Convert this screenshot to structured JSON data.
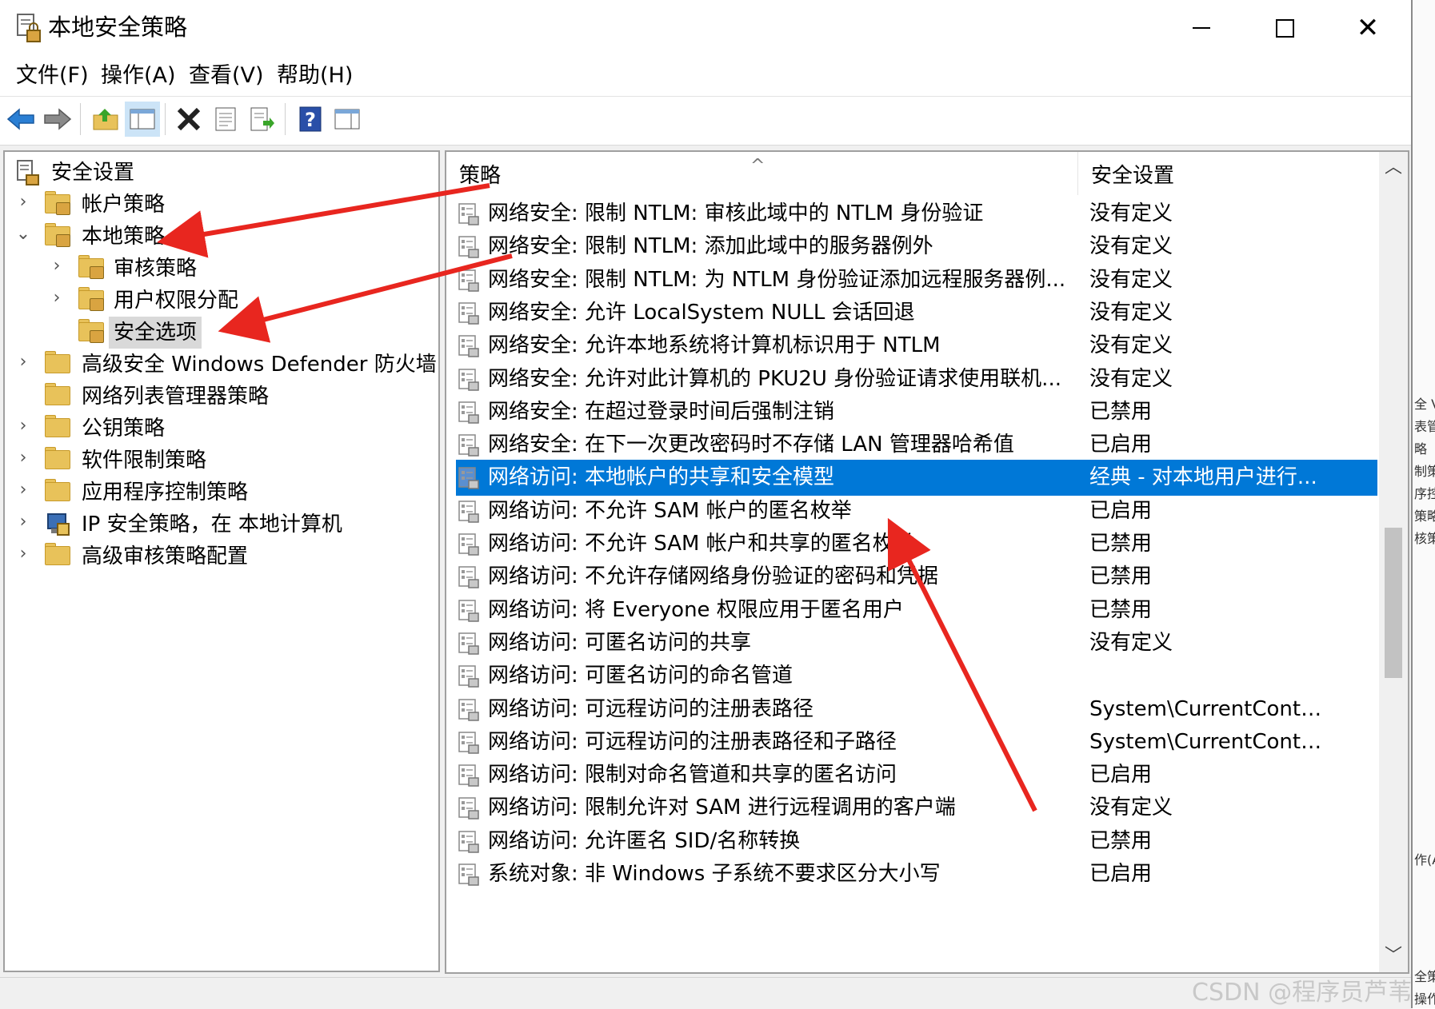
{
  "window": {
    "title": "本地安全策略"
  },
  "menu": [
    "文件(F)",
    "操作(A)",
    "查看(V)",
    "帮助(H)"
  ],
  "tree": [
    {
      "label": "安全设置",
      "icon": "security-settings-icon",
      "chevron": ""
    },
    {
      "label": "帐户策略",
      "icon": "folder-lock-icon",
      "chevron": "›"
    },
    {
      "label": "本地策略",
      "icon": "folder-lock-icon",
      "chevron": "⌄"
    },
    {
      "label": "审核策略",
      "icon": "folder-lock-icon",
      "chevron": "›"
    },
    {
      "label": "用户权限分配",
      "icon": "folder-lock-icon",
      "chevron": "›"
    },
    {
      "label": "安全选项",
      "icon": "folder-lock-icon",
      "chevron": ""
    },
    {
      "label": "高级安全 Windows Defender 防火墙",
      "icon": "folder-icon",
      "chevron": "›"
    },
    {
      "label": "网络列表管理器策略",
      "icon": "folder-icon",
      "chevron": ""
    },
    {
      "label": "公钥策略",
      "icon": "folder-icon",
      "chevron": "›"
    },
    {
      "label": "软件限制策略",
      "icon": "folder-icon",
      "chevron": "›"
    },
    {
      "label": "应用程序控制策略",
      "icon": "folder-icon",
      "chevron": "›"
    },
    {
      "label": "IP 安全策略，在 本地计算机",
      "icon": "ip-security-icon",
      "chevron": "›"
    },
    {
      "label": "高级审核策略配置",
      "icon": "folder-icon",
      "chevron": "›"
    }
  ],
  "list": {
    "columns": {
      "policy": "策略",
      "setting": "安全设置"
    },
    "sort_indicator": "^",
    "rows": [
      {
        "policy": "网络安全: 限制 NTLM: 审核此域中的 NTLM 身份验证",
        "setting": "没有定义"
      },
      {
        "policy": "网络安全: 限制 NTLM: 添加此域中的服务器例外",
        "setting": "没有定义"
      },
      {
        "policy": "网络安全: 限制 NTLM: 为 NTLM 身份验证添加远程服务器例...",
        "setting": "没有定义"
      },
      {
        "policy": "网络安全: 允许 LocalSystem NULL 会话回退",
        "setting": "没有定义"
      },
      {
        "policy": "网络安全: 允许本地系统将计算机标识用于 NTLM",
        "setting": "没有定义"
      },
      {
        "policy": "网络安全: 允许对此计算机的 PKU2U 身份验证请求使用联机...",
        "setting": "没有定义"
      },
      {
        "policy": "网络安全: 在超过登录时间后强制注销",
        "setting": "已禁用"
      },
      {
        "policy": "网络安全: 在下一次更改密码时不存储 LAN 管理器哈希值",
        "setting": "已启用"
      },
      {
        "policy": "网络访问: 本地帐户的共享和安全模型",
        "setting": "经典 - 对本地用户进行..."
      },
      {
        "policy": "网络访问: 不允许 SAM 帐户的匿名枚举",
        "setting": "已启用"
      },
      {
        "policy": "网络访问: 不允许 SAM 帐户和共享的匿名枚举",
        "setting": "已禁用"
      },
      {
        "policy": "网络访问: 不允许存储网络身份验证的密码和凭据",
        "setting": "已禁用"
      },
      {
        "policy": "网络访问: 将 Everyone 权限应用于匿名用户",
        "setting": "已禁用"
      },
      {
        "policy": "网络访问: 可匿名访问的共享",
        "setting": "没有定义"
      },
      {
        "policy": "网络访问: 可匿名访问的命名管道",
        "setting": ""
      },
      {
        "policy": "网络访问: 可远程访问的注册表路径",
        "setting": "System\\CurrentControl..."
      },
      {
        "policy": "网络访问: 可远程访问的注册表路径和子路径",
        "setting": "System\\CurrentControl..."
      },
      {
        "policy": "网络访问: 限制对命名管道和共享的匿名访问",
        "setting": "已启用"
      },
      {
        "policy": "网络访问: 限制允许对 SAM 进行远程调用的客户端",
        "setting": "没有定义"
      },
      {
        "policy": "网络访问: 允许匿名 SID/名称转换",
        "setting": "已禁用"
      },
      {
        "policy": "系统对象: 非 Windows 子系统不要求区分大小写",
        "setting": "已启用"
      }
    ]
  },
  "scrollbar": {
    "up": "︿",
    "down": "﹀"
  },
  "peek_fragments": [
    "全 V",
    "表管",
    "略",
    "制策",
    "序控",
    "策略",
    "核策",
    "作(A)",
    "全策",
    "操作"
  ],
  "watermark": "CSDN @程序员芦苇",
  "accent_color": "#0078d7",
  "annotation_color": "#e8261f"
}
